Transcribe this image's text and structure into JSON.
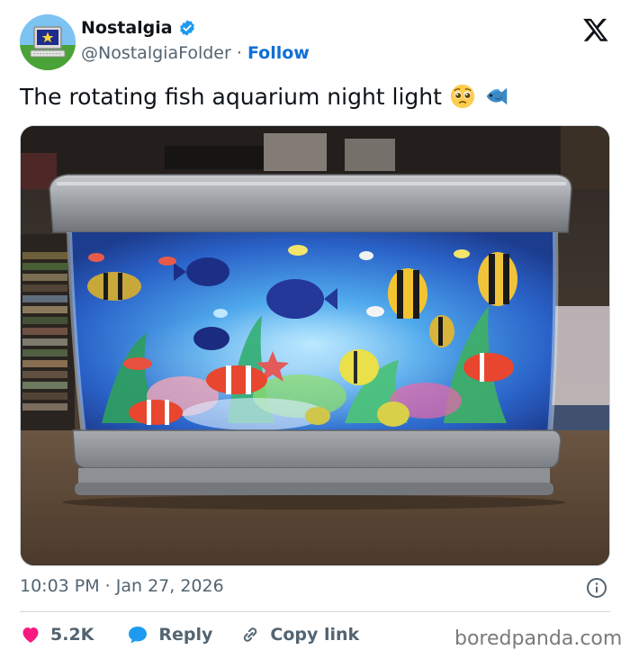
{
  "author": {
    "name": "Nostalgia",
    "handle": "@NostalgiaFolder",
    "separator": "·",
    "follow_label": "Follow",
    "verified_color": "#1d9bf0"
  },
  "tweet": {
    "text": "The rotating fish aquarium night light",
    "emojis": [
      "pleading-face-emoji",
      "fish-emoji"
    ]
  },
  "media": {
    "description_icon": "aquarium-photo"
  },
  "meta": {
    "timestamp": "10:03 PM · Jan 27, 2026"
  },
  "actions": {
    "like_count": "5.2K",
    "reply_label": "Reply",
    "copy_label": "Copy link"
  },
  "watermark": "boredpanda.com",
  "colors": {
    "like": "#f91880",
    "reply": "#1d9bf0",
    "follow": "#0f6fd6",
    "muted": "#536471"
  }
}
